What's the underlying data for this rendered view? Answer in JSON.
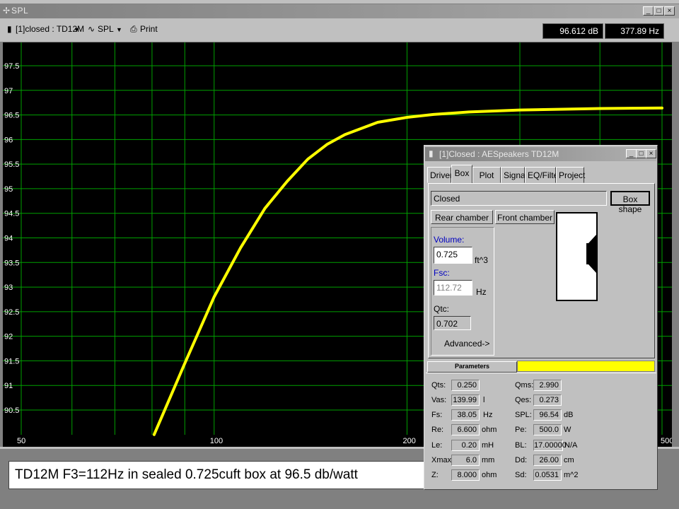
{
  "window": {
    "title": "SPL"
  },
  "toolbar": {
    "driver_selector": "[1]closed : TD12M",
    "graph_selector": "SPL",
    "print_label": "Print",
    "readout_db": "96.612 dB",
    "readout_hz": "377.89 Hz"
  },
  "chart_data": {
    "type": "line",
    "x_scale": "log",
    "xlim": [
      50,
      500
    ],
    "ylim": [
      90,
      98
    ],
    "x_ticks": [
      "50",
      "100",
      "200",
      "500"
    ],
    "y_ticks": [
      "97.5",
      "97",
      "96.5",
      "96",
      "95.5",
      "95",
      "94.5",
      "94",
      "93.5",
      "93",
      "92.5",
      "92",
      "91.5",
      "91",
      "90.5"
    ],
    "grid": true,
    "series": [
      {
        "color": "#ffff00",
        "x": [
          80.6,
          90,
          100,
          110,
          120,
          130,
          140,
          150,
          160,
          180,
          200,
          220,
          250,
          300,
          400,
          500
        ],
        "y": [
          90.0,
          91.45,
          92.8,
          93.8,
          94.6,
          95.15,
          95.6,
          95.9,
          96.1,
          96.35,
          96.45,
          96.51,
          96.56,
          96.6,
          96.63,
          96.64
        ]
      }
    ]
  },
  "caption": "TD12M  F3=112Hz in sealed 0.725cuft box at 96.5 db/watt",
  "dialog": {
    "title": "[1]Closed : AESpeakers TD12M",
    "tabs": [
      "Driver",
      "Box",
      "Plot",
      "Signal",
      "EQ/Filter",
      "Project"
    ],
    "box_type": "Closed",
    "box_shape_label": "Box shape",
    "rear_chamber_label": "Rear chamber",
    "front_chamber_label": "Front chamber",
    "volume_label": "Volume:",
    "volume_value": "0.725",
    "volume_unit": "ft^3",
    "fsc_label": "Fsc:",
    "fsc_value": "112.72",
    "fsc_unit": "Hz",
    "qtc_label": "Qtc:",
    "qtc_value": "0.702",
    "advanced_label": "Advanced->",
    "parameters_label": "Parameters",
    "params_left": [
      {
        "label": "Qts:",
        "value": "0.250",
        "unit": ""
      },
      {
        "label": "Vas:",
        "value": "139.99",
        "unit": "l"
      },
      {
        "label": "Fs:",
        "value": "38.05",
        "unit": "Hz"
      },
      {
        "label": "Re:",
        "value": "6.600",
        "unit": "ohm"
      },
      {
        "label": "Le:",
        "value": "0.20",
        "unit": "mH"
      },
      {
        "label": "Xmax:",
        "value": "6.0",
        "unit": "mm"
      },
      {
        "label": "Z:",
        "value": "8.000",
        "unit": "ohm"
      }
    ],
    "params_right": [
      {
        "label": "Qms:",
        "value": "2.990",
        "unit": ""
      },
      {
        "label": "Qes:",
        "value": "0.273",
        "unit": ""
      },
      {
        "label": "SPL:",
        "value": "96.54",
        "unit": "dB"
      },
      {
        "label": "Pe:",
        "value": "500.0",
        "unit": "W"
      },
      {
        "label": "BL:",
        "value": "17.00000",
        "unit": "N/A"
      },
      {
        "label": "Dd:",
        "value": "26.00",
        "unit": "cm"
      },
      {
        "label": "Sd:",
        "value": "0.0531",
        "unit": "m^2"
      }
    ]
  }
}
